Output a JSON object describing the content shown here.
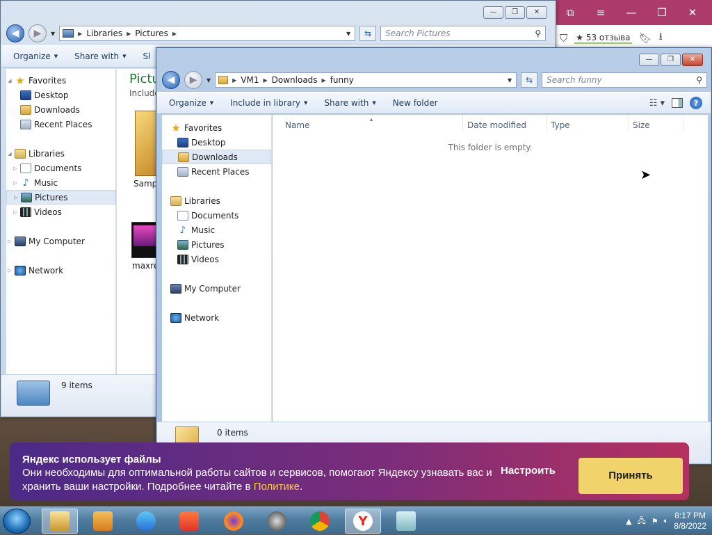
{
  "yandex": {
    "rating": "★ 53 отзыва"
  },
  "win1": {
    "path": [
      "Libraries",
      "Pictures"
    ],
    "search_placeholder": "Search Pictures",
    "toolbar": {
      "organize": "Organize",
      "share": "Share with",
      "slide": "Sl"
    },
    "nav": [
      {
        "label": "Favorites",
        "icon": "star"
      },
      {
        "label": "Desktop",
        "icon": "desktop"
      },
      {
        "label": "Downloads",
        "icon": "downloads"
      },
      {
        "label": "Recent Places",
        "icon": "recent"
      },
      {
        "label": "Libraries",
        "icon": "library"
      },
      {
        "label": "Documents",
        "icon": "documents"
      },
      {
        "label": "Music",
        "icon": "music"
      },
      {
        "label": "Pictures",
        "icon": "pictures"
      },
      {
        "label": "Videos",
        "icon": "videos"
      },
      {
        "label": "My Computer",
        "icon": "computer"
      },
      {
        "label": "Network",
        "icon": "network"
      }
    ],
    "content_title": "Pictu",
    "content_sub": "Include",
    "file1": "Sampl",
    "file2": "maxres",
    "status": "9 items"
  },
  "win2": {
    "path": [
      "VM1",
      "Downloads",
      "funny"
    ],
    "search_placeholder": "Search funny",
    "toolbar": {
      "organize": "Organize",
      "include": "Include in library",
      "share": "Share with",
      "newfolder": "New folder"
    },
    "nav": [
      {
        "label": "Favorites"
      },
      {
        "label": "Desktop"
      },
      {
        "label": "Downloads"
      },
      {
        "label": "Recent Places"
      },
      {
        "label": "Libraries"
      },
      {
        "label": "Documents"
      },
      {
        "label": "Music"
      },
      {
        "label": "Pictures"
      },
      {
        "label": "Videos"
      },
      {
        "label": "My Computer"
      },
      {
        "label": "Network"
      }
    ],
    "columns": {
      "name": "Name",
      "date": "Date modified",
      "type": "Type",
      "size": "Size"
    },
    "empty": "This folder is empty.",
    "status": "0 items"
  },
  "banner": {
    "title": "Яндекс использует файлы",
    "text": "Они необходимы для оптимальной работы сайтов и сервисов, помогают Яндексу узнавать вас и хранить ваши настройки. Подробнее читайте в ",
    "link": "Политике",
    "text_end": ".",
    "configure": "Настроить",
    "accept": "Принять"
  },
  "taskbar": {
    "time": "8:17 PM",
    "date": "8/8/2022"
  }
}
